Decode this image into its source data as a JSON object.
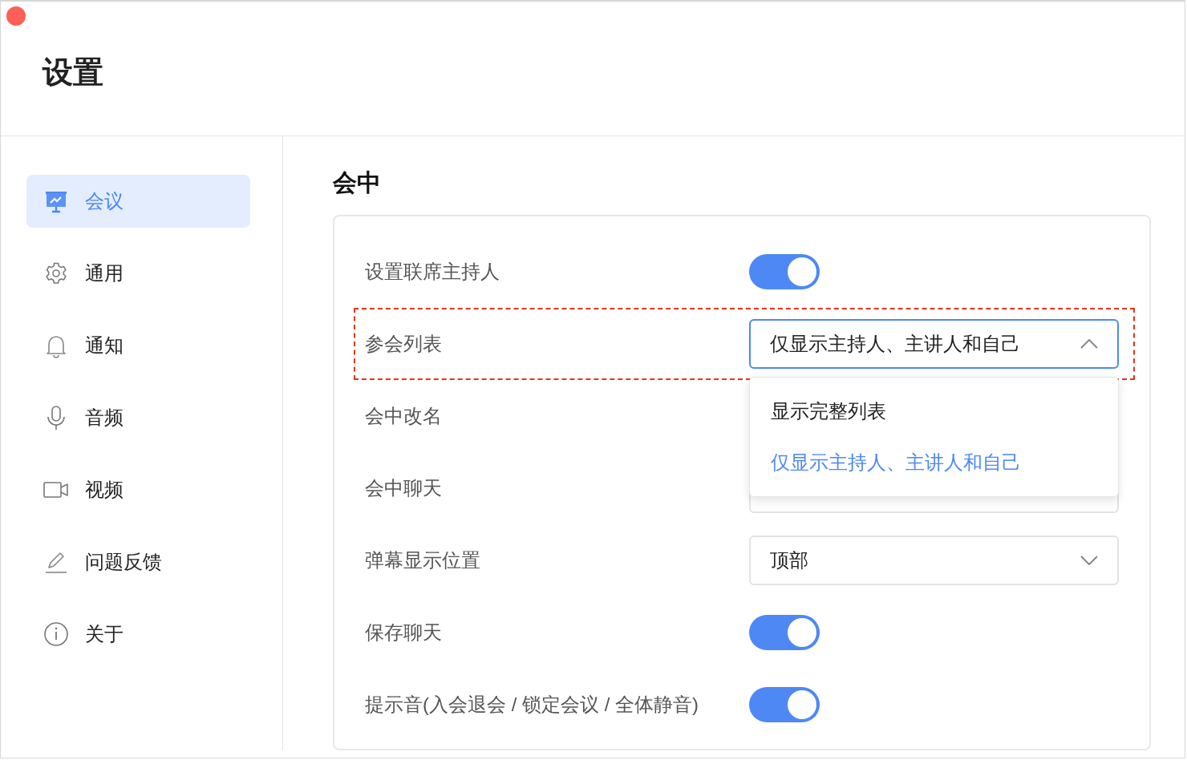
{
  "window": {
    "title": "设置"
  },
  "sidebar": {
    "items": [
      {
        "label": "会议",
        "selected": true
      },
      {
        "label": "通用",
        "selected": false
      },
      {
        "label": "通知",
        "selected": false
      },
      {
        "label": "音频",
        "selected": false
      },
      {
        "label": "视频",
        "selected": false
      },
      {
        "label": "问题反馈",
        "selected": false
      },
      {
        "label": "关于",
        "selected": false
      }
    ]
  },
  "section": {
    "title": "会中",
    "rows": [
      {
        "kind": "toggle",
        "label": "设置联席主持人",
        "on": true
      },
      {
        "kind": "select",
        "label": "参会列表",
        "value": "仅显示主持人、主讲人和自己",
        "expanded": true,
        "highlighted": true,
        "options": [
          {
            "label": "显示完整列表",
            "selected": false
          },
          {
            "label": "仅显示主持人、主讲人和自己",
            "selected": true
          }
        ]
      },
      {
        "kind": "covered",
        "label": "会中改名"
      },
      {
        "kind": "select",
        "label": "会中聊天",
        "expanded": false
      },
      {
        "kind": "select",
        "label": "弹幕显示位置",
        "value": "顶部",
        "expanded": false
      },
      {
        "kind": "toggle",
        "label": "保存聊天",
        "on": true
      },
      {
        "kind": "toggle",
        "label": "提示音(入会退会 / 锁定会议 / 全体静音)",
        "on": true
      }
    ]
  }
}
